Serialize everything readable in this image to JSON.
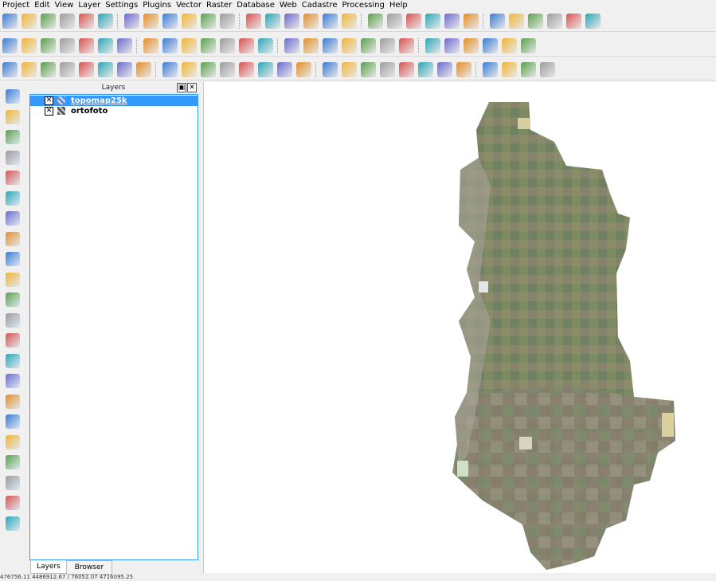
{
  "menu": [
    "Project",
    "Edit",
    "View",
    "Layer",
    "Settings",
    "Plugins",
    "Vector",
    "Raster",
    "Database",
    "Web",
    "Cadastre",
    "Processing",
    "Help"
  ],
  "layers_panel": {
    "title": "Layers",
    "float_button": "▣",
    "close_button": "✕",
    "layers": [
      {
        "name": "topomap25k",
        "checked": "✕",
        "selected": true
      },
      {
        "name": "ortofoto",
        "checked": "✕",
        "selected": false
      }
    ]
  },
  "tabs": [
    "Layers",
    "Browser"
  ],
  "status": {
    "coordinates": "476756.11 4486912.67 / 76052.07 4716095.25"
  },
  "colors": {
    "selection": "#3399ff",
    "canvas_bg": "#ffffff",
    "map_green": "#7a8a5a"
  },
  "icons": {
    "toolbar1": [
      "new-project-icon",
      "open-project-icon",
      "save-project-icon",
      "save-as-icon",
      "new-print-composer-icon",
      "composer-manager-icon",
      "touch-zoom-pan-icon",
      "pan-map-icon",
      "pan-to-selection-icon",
      "zoom-in-icon",
      "zoom-out-icon",
      "zoom-actual-size-icon",
      "zoom-full-icon",
      "zoom-to-selection-icon",
      "zoom-to-layer-icon",
      "zoom-last-icon",
      "zoom-next-icon",
      "refresh-icon",
      "identify-icon",
      "select-features-icon",
      "deselect-icon",
      "select-by-expression-icon",
      "open-attribute-table-icon",
      "field-calculator-icon",
      "measure-line-icon",
      "map-tips-icon",
      "new-bookmark-icon",
      "show-bookmarks-icon",
      "text-annotation-icon",
      "help-icon"
    ],
    "toolbar2": [
      "label-tool-icon",
      "pin-label-icon",
      "show-hide-label-icon",
      "move-label-icon",
      "rotate-label-icon",
      "change-label-icon",
      "georeferencer-icon",
      "raster-calculator-icon",
      "coordinate-capture-icon",
      "gps-tools-icon",
      "road-graph-icon",
      "spatial-query-icon",
      "db-manager-icon",
      "openlayers-icon",
      "autocad-icon",
      "wms-icon",
      "plugin-icon",
      "add-feature-icon",
      "toggle-editing-icon",
      "digitize-icon",
      "save-edits-icon",
      "move-feature-icon",
      "node-tool-icon",
      "delete-selected-icon",
      "cut-features-icon",
      "copy-features-icon",
      "paste-features-icon"
    ],
    "toolbar3": [
      "undo-icon",
      "redo-icon",
      "simplify-feature-icon",
      "add-ring-icon",
      "add-part-icon",
      "fill-ring-icon",
      "delete-ring-icon",
      "delete-part-icon",
      "reshape-features-icon",
      "offset-curve-icon",
      "split-features-icon",
      "split-parts-icon",
      "merge-features-icon",
      "merge-attributes-icon",
      "rotate-point-symbols-icon",
      "histogram-icon",
      "raster-stats-icon",
      "band-stretch-icon",
      "local-stretch-icon",
      "increase-brightness-icon",
      "decrease-brightness-icon",
      "increase-contrast-icon",
      "decrease-contrast-icon",
      "grid-icon",
      "hand-icon",
      "raster-info-icon",
      "sum-icon",
      "layer-tools-icon"
    ],
    "left": [
      "add-vector-layer-icon",
      "add-raster-layer-icon",
      "add-postgis-layer-icon",
      "add-spatialite-layer-icon",
      "add-mssql-layer-icon",
      "add-oracle-layer-icon",
      "add-sqlanywhere-layer-icon",
      "add-wms-layer-icon",
      "add-wcs-layer-icon",
      "add-wfs-layer-icon",
      "add-delimited-text-icon",
      "new-shapefile-icon",
      "new-spatialite-icon",
      "new-temporary-layer-icon",
      "remove-layer-icon",
      "group-layers-icon",
      "spatial-bookmark-icon",
      "node-tool-icon",
      "add-circle-icon",
      "move-label-icon",
      "virtual-layer-icon",
      "georeference-icon"
    ]
  }
}
